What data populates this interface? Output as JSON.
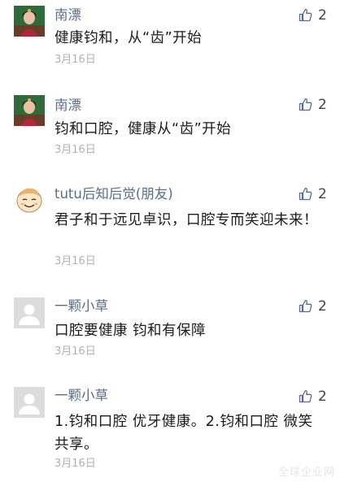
{
  "comments": [
    {
      "author": "南漂",
      "avatar": "photo-avatar",
      "likes": "2",
      "text": "健康钧和，从“齿”开始",
      "date": "3月16日"
    },
    {
      "author": "南漂",
      "avatar": "photo-avatar",
      "likes": "2",
      "text": "钧和口腔，健康从“齿”开始",
      "date": "3月16日"
    },
    {
      "author": "tutu后知后觉(朋友)",
      "avatar": "cartoon-avatar",
      "likes": "2",
      "text": "君子和于远见卓识，口腔专而笑迎未来！",
      "date": "3月16日"
    },
    {
      "author": "一颗小草",
      "avatar": "default-avatar",
      "likes": "2",
      "text": "口腔要健康 钧和有保障",
      "date": "3月16日"
    },
    {
      "author": "一颗小草",
      "avatar": "default-avatar",
      "likes": "2",
      "text": "1.钧和口腔 优牙健康。2.钧和口腔 微笑共享。",
      "date": "3月16日"
    }
  ],
  "watermark": "全球企业网",
  "colors": {
    "author": "#5a6c8a",
    "date": "#b2b2b2",
    "like_icon": "#5b6b8c",
    "body": "#1a1a1a"
  },
  "icons": {
    "like": "thumbs-up-icon"
  }
}
